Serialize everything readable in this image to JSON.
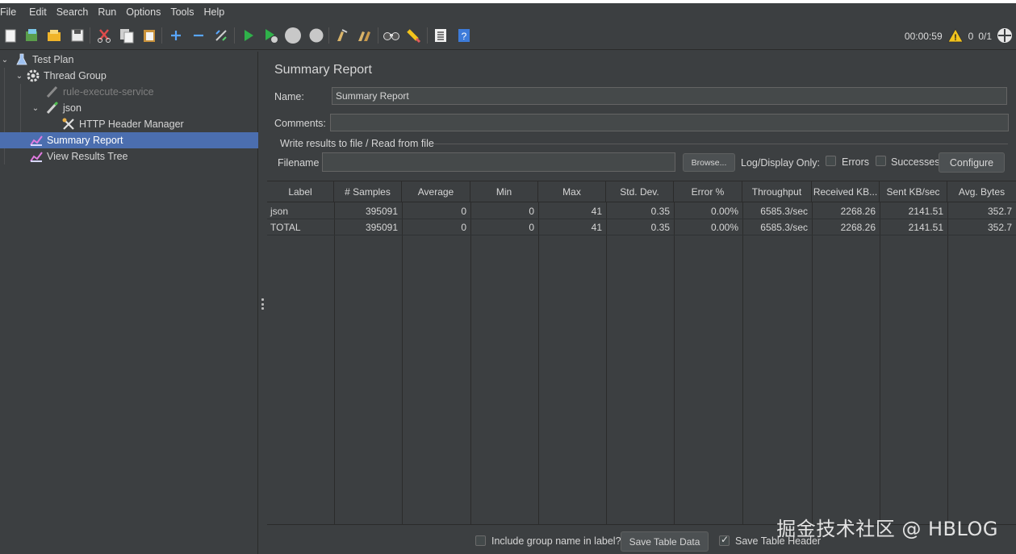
{
  "menubar": {
    "items": [
      {
        "label": "File"
      },
      {
        "label": "Edit"
      },
      {
        "label": "Search"
      },
      {
        "label": "Run"
      },
      {
        "label": "Options"
      },
      {
        "label": "Tools"
      },
      {
        "label": "Help"
      }
    ]
  },
  "toolbar": {
    "timer": "00:00:59",
    "warning_count": "0",
    "threads": "0/1"
  },
  "tree": {
    "items": [
      {
        "label": "Test Plan",
        "icon": "flask-icon"
      },
      {
        "label": "Thread Group",
        "icon": "gear-icon"
      },
      {
        "label": "rule-execute-service",
        "icon": "pipette-icon",
        "disabled": true
      },
      {
        "label": "json",
        "icon": "pipette-icon"
      },
      {
        "label": "HTTP Header Manager",
        "icon": "wrench-icon"
      },
      {
        "label": "Summary Report",
        "icon": "chart-icon",
        "selected": true
      },
      {
        "label": "View Results Tree",
        "icon": "chart-icon"
      }
    ]
  },
  "panel": {
    "title": "Summary Report",
    "name_label": "Name:",
    "name_value": "Summary Report",
    "comments_label": "Comments:",
    "comments_value": "",
    "file_section_label": "Write results to file / Read from file",
    "filename_label": "Filename",
    "filename_value": "",
    "browse_label": "Browse...",
    "log_display_label": "Log/Display Only:",
    "errors_label": "Errors",
    "successes_label": "Successes",
    "configure_label": "Configure"
  },
  "table": {
    "headers": [
      "Label",
      "# Samples",
      "Average",
      "Min",
      "Max",
      "Std. Dev.",
      "Error %",
      "Throughput",
      "Received KB...",
      "Sent KB/sec",
      "Avg. Bytes"
    ],
    "rows": [
      [
        "json",
        "395091",
        "0",
        "0",
        "41",
        "0.35",
        "0.00%",
        "6585.3/sec",
        "2268.26",
        "2141.51",
        "352.7"
      ],
      [
        "TOTAL",
        "395091",
        "0",
        "0",
        "41",
        "0.35",
        "0.00%",
        "6585.3/sec",
        "2268.26",
        "2141.51",
        "352.7"
      ]
    ]
  },
  "footer": {
    "include_group_label": "Include group name in label?",
    "save_table_data_label": "Save Table Data",
    "save_table_header_label": "Save Table Header",
    "save_table_header_checked": true
  },
  "watermark": "掘金技术社区 @ HBLOG",
  "colors": {
    "background": "#3c3f41",
    "selection": "#4b6eaf",
    "run_green": "#2fb14a",
    "warning_yellow": "#f2c31b"
  }
}
